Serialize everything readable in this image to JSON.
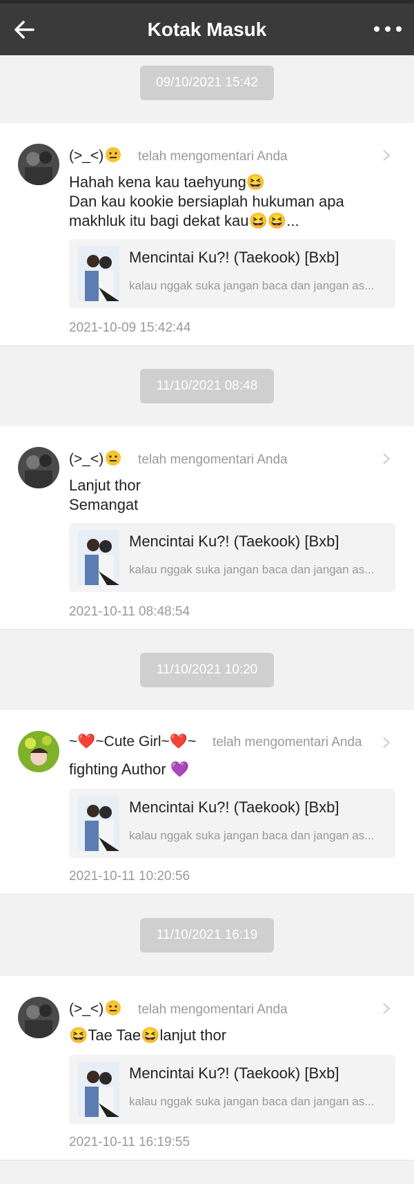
{
  "header": {
    "title": "Kotak Masuk",
    "back_icon": "arrow-left-icon",
    "menu_icon": "more-horizontal-icon"
  },
  "colors": {
    "topbar": "#3a3a3a",
    "badge": "#cfcfcf",
    "background": "#f2f2f2"
  },
  "items": [
    {
      "date": "09/10/2021 15:42",
      "user": "(>_<)",
      "action": "telah mengomentari Anda",
      "message": "Hahah kena kau taehyung😆\nDan kau kookie bersiaplah hukuman apa makhluk itu bagi dekat kau😆😆...",
      "book_title": "Mencintai Ku?! (Taekook) [Bxb]",
      "book_desc": "kalau nggak suka jangan baca dan jangan as...",
      "timestamp": "2021-10-09 15:42:44"
    },
    {
      "date": "11/10/2021 08:48",
      "user": "(>_<)",
      "action": "telah mengomentari Anda",
      "message": "Lanjut thor\nSemangat",
      "book_title": "Mencintai Ku?! (Taekook) [Bxb]",
      "book_desc": "kalau nggak suka jangan baca dan jangan as...",
      "timestamp": "2021-10-11 08:48:54"
    },
    {
      "date": "11/10/2021 10:20",
      "user": "~❤️~Cute Girl~❤️~",
      "action": "telah mengomentari Anda",
      "message": "fighting Author 💜",
      "book_title": "Mencintai Ku?! (Taekook) [Bxb]",
      "book_desc": "kalau nggak suka jangan baca dan jangan as...",
      "timestamp": "2021-10-11 10:20:56"
    },
    {
      "date": "11/10/2021 16:19",
      "user": "(>_<)",
      "action": "telah mengomentari Anda",
      "message": "😆Tae Tae😆lanjut thor",
      "book_title": "Mencintai Ku?! (Taekook) [Bxb]",
      "book_desc": "kalau nggak suka jangan baca dan jangan as...",
      "timestamp": "2021-10-11 16:19:55"
    }
  ]
}
